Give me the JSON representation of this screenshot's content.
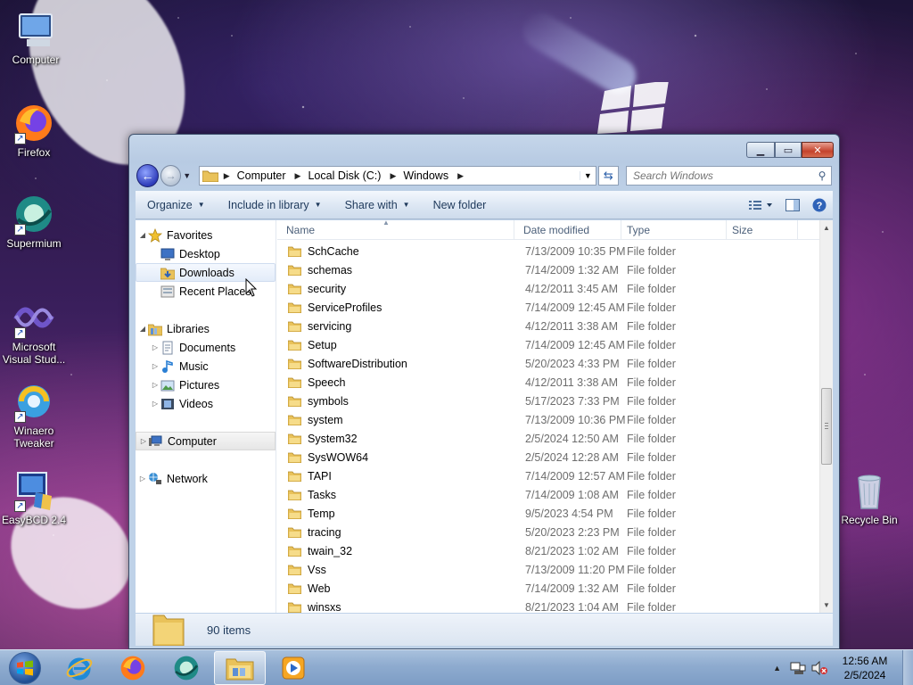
{
  "desktop": {
    "icons": [
      {
        "label": "Computer",
        "icon": "computer-icon"
      },
      {
        "label": "Firefox",
        "icon": "firefox-icon"
      },
      {
        "label": "Supermium",
        "icon": "supermium-icon"
      },
      {
        "label": "Microsoft Visual Stud...",
        "icon": "visual-studio-icon"
      },
      {
        "label": "Winaero Tweaker",
        "icon": "winaero-icon"
      },
      {
        "label": "EasyBCD 2.4",
        "icon": "easybcd-icon"
      },
      {
        "label": "Recycle Bin",
        "icon": "recycle-bin-icon"
      }
    ]
  },
  "window": {
    "address": {
      "segments": [
        "Computer",
        "Local Disk (C:)",
        "Windows"
      ]
    },
    "search": {
      "placeholder": "Search Windows"
    },
    "toolbar": {
      "organize": "Organize",
      "include_in_library": "Include in library",
      "share_with": "Share with",
      "new_folder": "New folder"
    },
    "nav": {
      "favorites": "Favorites",
      "desktop": "Desktop",
      "downloads": "Downloads",
      "recent_places": "Recent Places",
      "libraries": "Libraries",
      "documents": "Documents",
      "music": "Music",
      "pictures": "Pictures",
      "videos": "Videos",
      "computer": "Computer",
      "network": "Network"
    },
    "columns": {
      "name": "Name",
      "date": "Date modified",
      "type": "Type",
      "size": "Size"
    },
    "files": [
      {
        "name": "SchCache",
        "date": "7/13/2009 10:35 PM",
        "type": "File folder"
      },
      {
        "name": "schemas",
        "date": "7/14/2009 1:32 AM",
        "type": "File folder"
      },
      {
        "name": "security",
        "date": "4/12/2011 3:45 AM",
        "type": "File folder"
      },
      {
        "name": "ServiceProfiles",
        "date": "7/14/2009 12:45 AM",
        "type": "File folder"
      },
      {
        "name": "servicing",
        "date": "4/12/2011 3:38 AM",
        "type": "File folder"
      },
      {
        "name": "Setup",
        "date": "7/14/2009 12:45 AM",
        "type": "File folder"
      },
      {
        "name": "SoftwareDistribution",
        "date": "5/20/2023 4:33 PM",
        "type": "File folder"
      },
      {
        "name": "Speech",
        "date": "4/12/2011 3:38 AM",
        "type": "File folder"
      },
      {
        "name": "symbols",
        "date": "5/17/2023 7:33 PM",
        "type": "File folder"
      },
      {
        "name": "system",
        "date": "7/13/2009 10:36 PM",
        "type": "File folder"
      },
      {
        "name": "System32",
        "date": "2/5/2024 12:50 AM",
        "type": "File folder"
      },
      {
        "name": "SysWOW64",
        "date": "2/5/2024 12:28 AM",
        "type": "File folder"
      },
      {
        "name": "TAPI",
        "date": "7/14/2009 12:57 AM",
        "type": "File folder"
      },
      {
        "name": "Tasks",
        "date": "7/14/2009 1:08 AM",
        "type": "File folder"
      },
      {
        "name": "Temp",
        "date": "9/5/2023 4:54 PM",
        "type": "File folder"
      },
      {
        "name": "tracing",
        "date": "5/20/2023 2:23 PM",
        "type": "File folder"
      },
      {
        "name": "twain_32",
        "date": "8/21/2023 1:02 AM",
        "type": "File folder"
      },
      {
        "name": "Vss",
        "date": "7/13/2009 11:20 PM",
        "type": "File folder"
      },
      {
        "name": "Web",
        "date": "7/14/2009 1:32 AM",
        "type": "File folder"
      },
      {
        "name": "winsxs",
        "date": "8/21/2023 1:04 AM",
        "type": "File folder"
      }
    ],
    "status": {
      "items_count": "90 items"
    }
  },
  "taskbar": {
    "apps": [
      "internet-explorer-icon",
      "firefox-icon",
      "supermium-icon",
      "explorer-icon",
      "media-player-icon"
    ],
    "clock": {
      "time": "12:56 AM",
      "date": "2/5/2024"
    }
  },
  "colors": {
    "accent": "#1e395b",
    "window_frame": "#b8cbe3",
    "close": "#c4432c"
  }
}
